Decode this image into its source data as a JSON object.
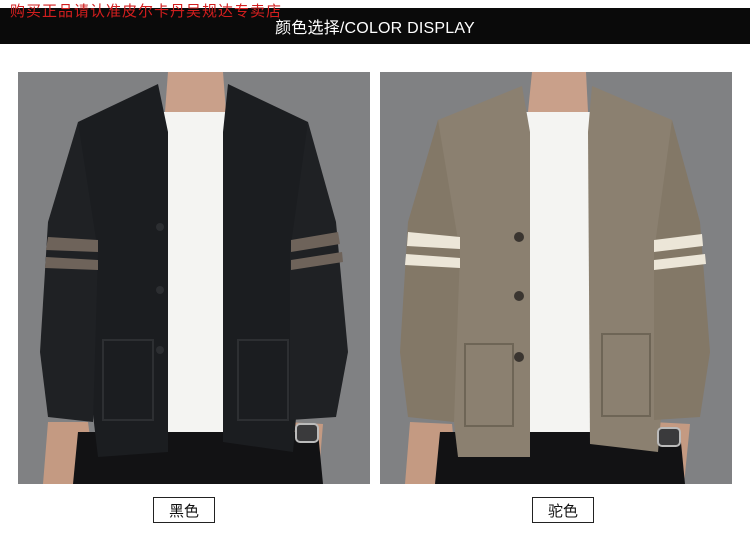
{
  "watermark": "购买正品请认准皮尔卡丹吴规达专卖店",
  "banner": {
    "title": "颜色选择/COLOR DISPLAY"
  },
  "colors": [
    {
      "label": "黑色",
      "swatch": "#1b1d20",
      "stripe": "#6e635a"
    },
    {
      "label": "驼色",
      "swatch": "#8b8070",
      "stripe": "#ece6d8"
    }
  ],
  "accent": {
    "banner_bg": "#0a0a0a",
    "watermark": "#d21e1e"
  }
}
